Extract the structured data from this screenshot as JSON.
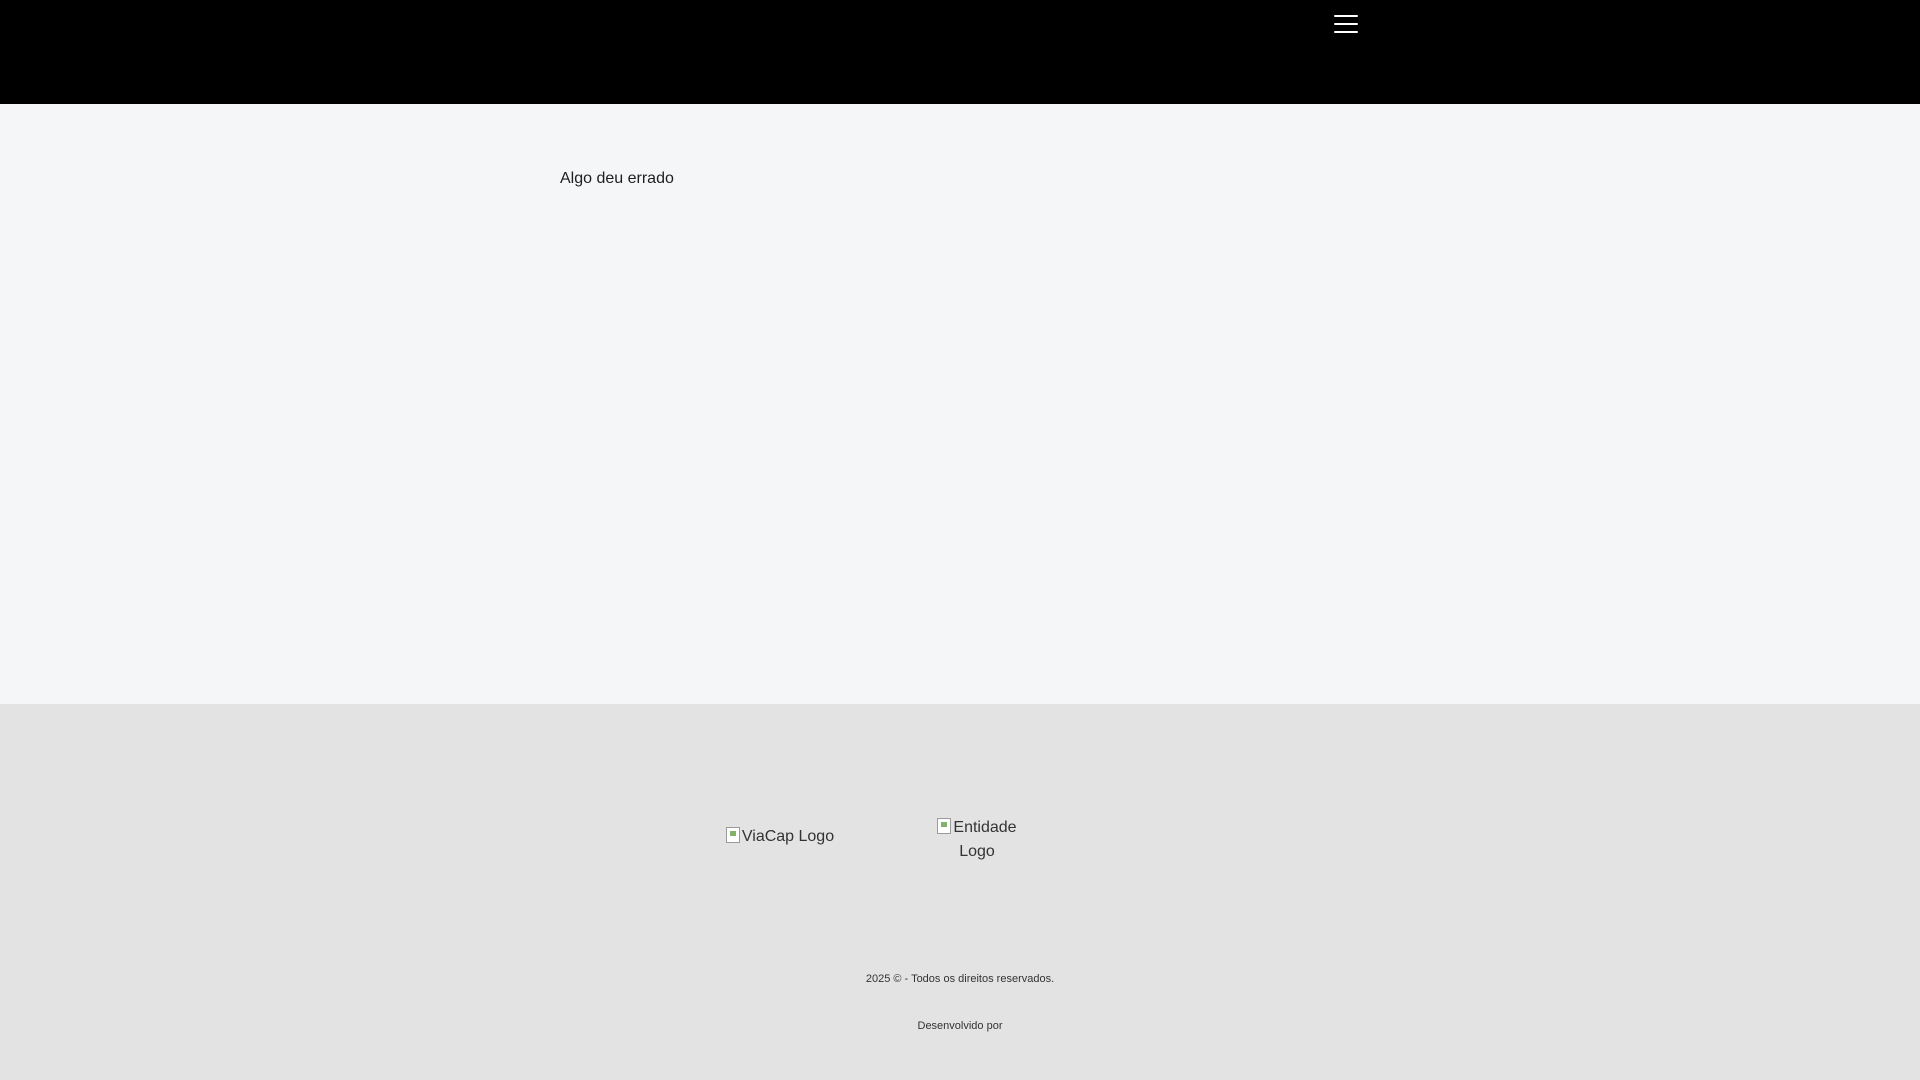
{
  "header": {
    "menu_icon": "hamburger-menu-icon",
    "background_color": "#000000"
  },
  "main": {
    "error_message": "Algo deu errado",
    "background_color": "#f4f6f8"
  },
  "footer": {
    "background_color": "#e3e3e3",
    "logos": {
      "viacap_alt": "ViaCap Logo",
      "entidade_alt": "Entidade Logo"
    },
    "copyright": "2025 © - Todos os direitos reservados.",
    "developed_by": "Desenvolvido por"
  }
}
